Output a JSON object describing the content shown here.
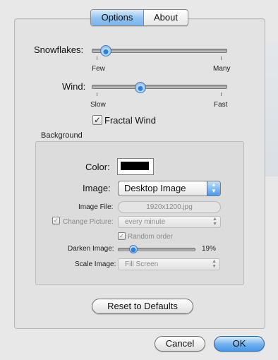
{
  "tabs": [
    {
      "label": "Options"
    },
    {
      "label": "About"
    }
  ],
  "snowflakes": {
    "label": "Snowflakes:",
    "min_label": "Few",
    "max_label": "Many",
    "value": 0.1
  },
  "wind": {
    "label": "Wind:",
    "min_label": "Slow",
    "max_label": "Fast",
    "value": 0.36
  },
  "fractal_wind": {
    "label": "Fractal Wind",
    "checked": true
  },
  "background": {
    "title": "Background",
    "color_label": "Color:",
    "color_value": "#000000",
    "image_label": "Image:",
    "image_value": "Desktop Image",
    "image_file_label": "Image File:",
    "image_file_value": "1920x1200.jpg",
    "change_picture_label": "Change Picture:",
    "change_picture_value": "every minute",
    "random_order_label": "Random order",
    "darken_label": "Darken Image:",
    "darken_value": "19%",
    "darken_level": 0.19,
    "scale_label": "Scale Image:",
    "scale_value": "Fill Screen"
  },
  "reset_label": "Reset to Defaults",
  "cancel_label": "Cancel",
  "ok_label": "OK",
  "colors": {
    "accent": "#6fb0f0",
    "checkbox_mark": "✓"
  }
}
